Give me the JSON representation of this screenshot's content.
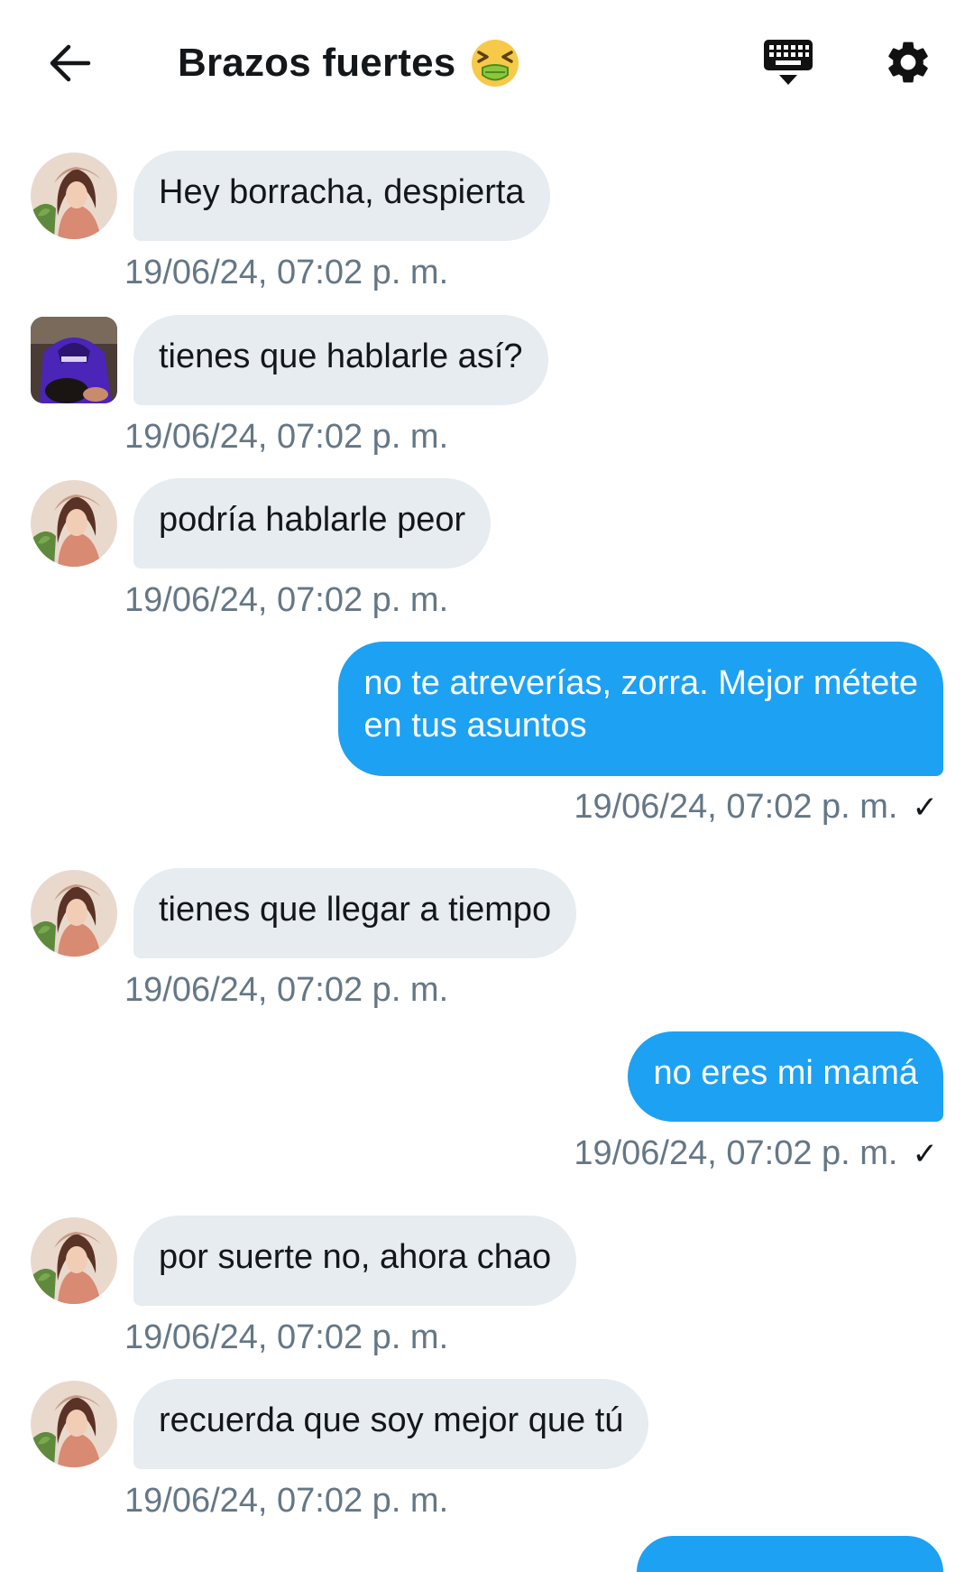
{
  "header": {
    "title": "Brazos fuertes",
    "title_emoji": "nauseated-face-emoji",
    "back_icon": "arrow-left-icon",
    "keyboard_icon": "keyboard-hide-icon",
    "settings_icon": "gear-icon"
  },
  "colors": {
    "incoming_bubble": "#e6ecf0",
    "outgoing_bubble": "#1da1f2",
    "timestamp": "#657786"
  },
  "messages": [
    {
      "direction": "in",
      "avatar": "avatar-woman",
      "text": "Hey borracha, despierta",
      "time": "19/06/24, 07:02 p. m."
    },
    {
      "direction": "in",
      "avatar": "avatar-purple-hoodie",
      "text": "tienes que hablarle así?",
      "time": "19/06/24, 07:02 p. m."
    },
    {
      "direction": "in",
      "avatar": "avatar-woman",
      "text": "podría hablarle peor",
      "time": "19/06/24, 07:02 p. m."
    },
    {
      "direction": "out",
      "text": "no te atreverías, zorra. Mejor métete\nen tus asuntos",
      "time": "19/06/24, 07:02 p. m.",
      "status": "✓"
    },
    {
      "direction": "in",
      "avatar": "avatar-woman",
      "text": "tienes que llegar a tiempo",
      "time": "19/06/24, 07:02 p. m."
    },
    {
      "direction": "out",
      "text": "no eres mi mamá",
      "time": "19/06/24, 07:02 p. m.",
      "status": "✓"
    },
    {
      "direction": "in",
      "avatar": "avatar-woman",
      "text": "por suerte no, ahora chao",
      "time": "19/06/24, 07:02 p. m."
    },
    {
      "direction": "in",
      "avatar": "avatar-woman",
      "text": "recuerda que soy mejor que tú",
      "time": "19/06/24, 07:02 p. m."
    }
  ]
}
